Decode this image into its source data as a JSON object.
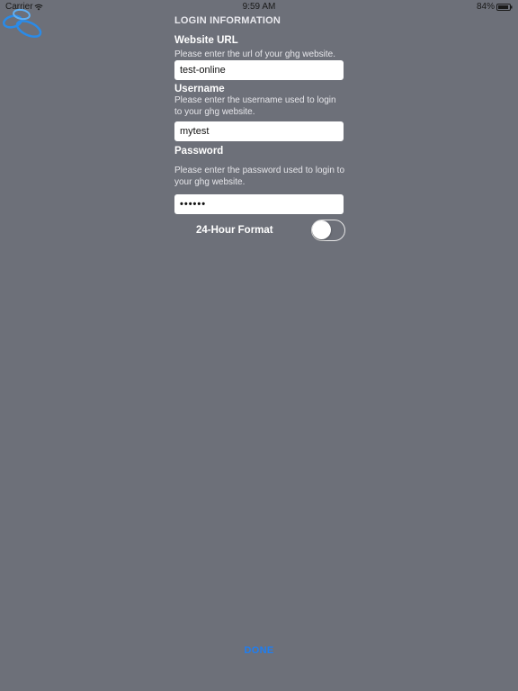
{
  "status_bar": {
    "carrier": "Carrier",
    "time": "9:59 AM",
    "battery": "84%"
  },
  "form": {
    "section_title": "LOGIN INFORMATION",
    "website_url": {
      "label": "Website URL",
      "help": "Please enter the url of your ghg website.",
      "value": "test-online"
    },
    "username": {
      "label": "Username",
      "help": "Please enter the username used to login to your ghg website.",
      "value": "mytest"
    },
    "password": {
      "label": "Password",
      "help": "Please enter the password used to login to your ghg website.",
      "value": "••••••"
    },
    "time_format": {
      "label": "24-Hour Format",
      "enabled": false
    }
  },
  "footer": {
    "done_label": "DONE"
  },
  "colors": {
    "background": "#6d7079",
    "accent": "#1f7ef1",
    "logo_blue": "#2a8be8"
  },
  "icons": [
    "logo-icon",
    "wifi-icon",
    "battery-icon"
  ]
}
